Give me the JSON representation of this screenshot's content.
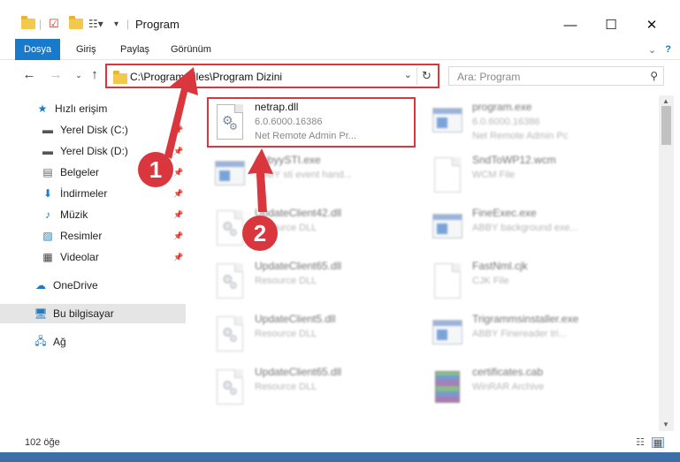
{
  "window": {
    "title": "Program",
    "minimize": "—",
    "maximize": "☐",
    "close": "✕"
  },
  "ribbon": {
    "tabs": [
      "Dosya",
      "Giriş",
      "Paylaş",
      "Görünüm"
    ]
  },
  "address": {
    "path": "C:\\Program Files\\Program Dizini"
  },
  "search": {
    "placeholder": "Ara: Program"
  },
  "nav": {
    "items": [
      {
        "label": "Hızlı erişim"
      },
      {
        "label": "Yerel Disk (C:)"
      },
      {
        "label": "Yerel Disk (D:)"
      },
      {
        "label": "Belgeler"
      },
      {
        "label": "İndirmeler"
      },
      {
        "label": "Müzik"
      },
      {
        "label": "Resimler"
      },
      {
        "label": "Videolar"
      },
      {
        "label": "OneDrive"
      },
      {
        "label": "Bu bilgisayar"
      },
      {
        "label": "Ağ"
      }
    ]
  },
  "files": [
    {
      "name": "netrap.dll",
      "line2": "6.0.6000.16386",
      "line3": "Net Remote Admin Pr..."
    },
    {
      "name": "program.exe",
      "line2": "6.0.6000.16386",
      "line3": "Net Remote Admin Pc"
    },
    {
      "name": "AbbyySTI.exe",
      "line2": "ABBY sti event hand...",
      "line3": ""
    },
    {
      "name": "SndToWP12.wcm",
      "line2": "WCM File",
      "line3": ""
    },
    {
      "name": "UpdateClient42.dll",
      "line2": "Resource DLL",
      "line3": ""
    },
    {
      "name": "FineExec.exe",
      "line2": "ABBY background exe...",
      "line3": ""
    },
    {
      "name": "UpdateClient65.dll",
      "line2": "Resource DLL",
      "line3": ""
    },
    {
      "name": "FastNml.cjk",
      "line2": "CJK File",
      "line3": ""
    },
    {
      "name": "UpdateClient5.dll",
      "line2": "Resource DLL",
      "line3": ""
    },
    {
      "name": "Trigrammsinstaller.exe",
      "line2": "ABBY Finereader tri...",
      "line3": ""
    },
    {
      "name": "UpdateClient65.dll",
      "line2": "Resource DLL",
      "line3": ""
    },
    {
      "name": "certificates.cab",
      "line2": "WinRAR Archive",
      "line3": ""
    }
  ],
  "annotations": {
    "step1": "1",
    "step2": "2",
    "color": "#d9363e"
  },
  "status": {
    "item_count": "102 öğe"
  }
}
